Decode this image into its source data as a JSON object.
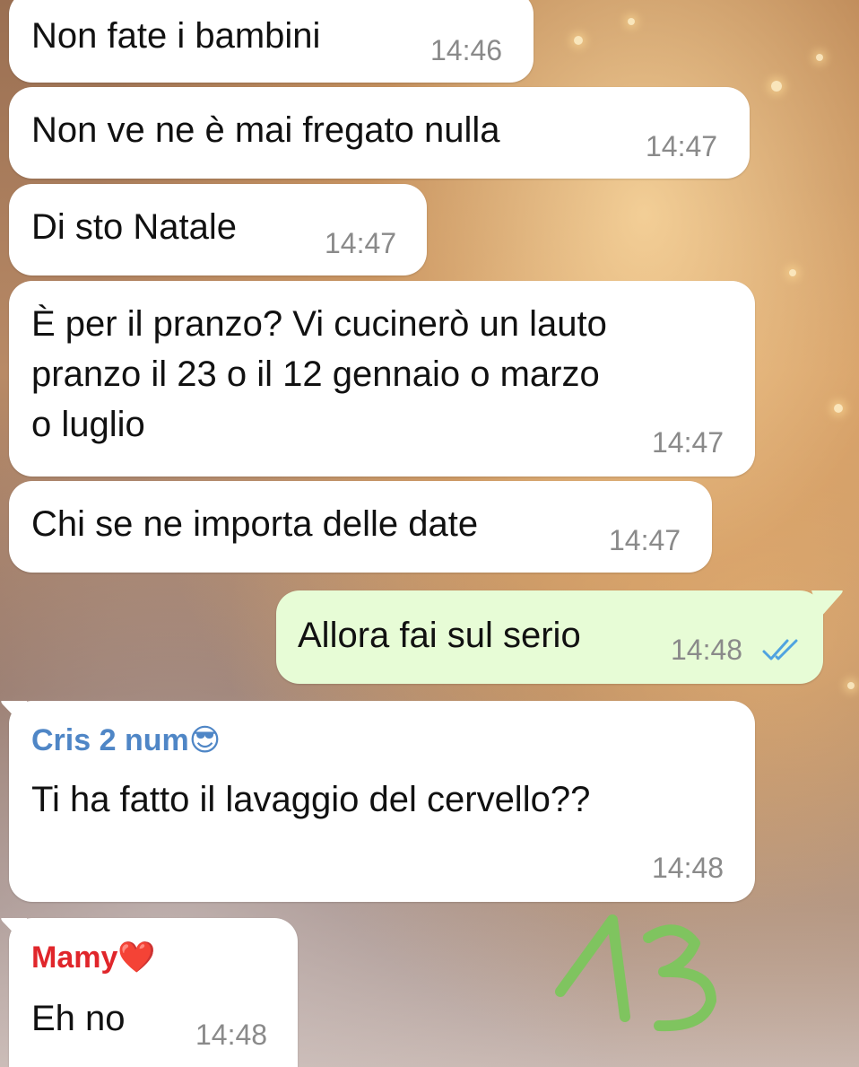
{
  "messages": [
    {
      "text": "Non fate i bambini",
      "time": "14:46"
    },
    {
      "text": "Non ve ne è mai fregato nulla",
      "time": "14:47"
    },
    {
      "text": "Di sto Natale",
      "time": "14:47"
    },
    {
      "text": "È per il pranzo? Vi cucinerò un lauto\npranzo il 23 o il 12 gennaio o marzo\no luglio",
      "time": "14:47"
    },
    {
      "text": "Chi se ne importa delle date",
      "time": "14:47"
    },
    {
      "text": "Allora fai sul serio",
      "time": "14:48",
      "status": "read-double-check"
    },
    {
      "sender": "Cris 2 num😎",
      "text": "Ti ha fatto il lavaggio del cervello??",
      "time": "14:48"
    },
    {
      "sender": "Mamy❤️",
      "text": "Eh no",
      "time": "14:48"
    }
  ],
  "colors": {
    "incoming_bubble": "#ffffff",
    "outgoing_bubble": "#e7fcd6",
    "sender_cris": "#4f86c6",
    "sender_mamy": "#e0262b",
    "read_ticks": "#4fa3e0",
    "annotation": "#7fc45f"
  },
  "annotation": {
    "text": "13"
  }
}
